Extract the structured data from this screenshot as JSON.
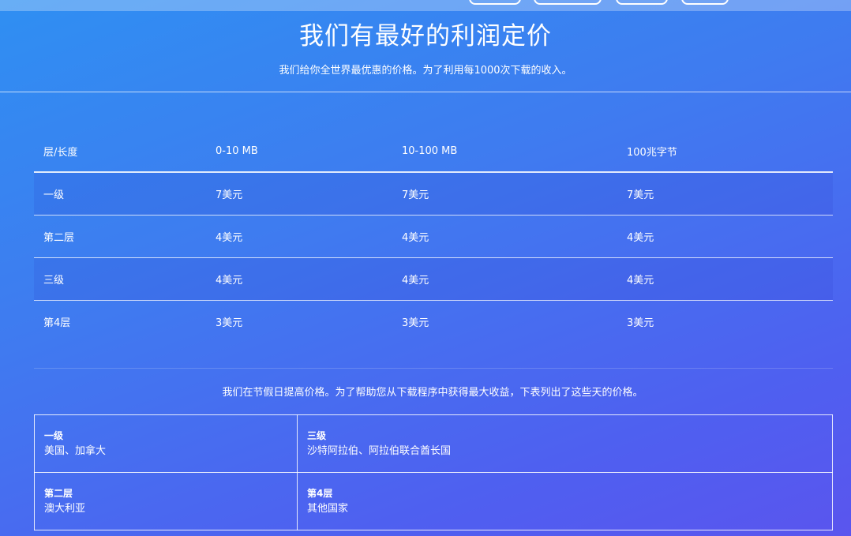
{
  "hero": {
    "title": "我们有最好的利润定价",
    "subtitle": "我们给你全世界最优惠的价格。为了利用每1000次下载的收入。"
  },
  "pricing_table": {
    "headers": [
      "层/长度",
      "0-10 MB",
      "10-100 MB",
      "100兆字节"
    ],
    "rows": [
      [
        "一级",
        "7美元",
        "7美元",
        "7美元"
      ],
      [
        "第二层",
        "4美元",
        "4美元",
        "4美元"
      ],
      [
        "三级",
        "4美元",
        "4美元",
        "4美元"
      ],
      [
        "第4层",
        "3美元",
        "3美元",
        "3美元"
      ]
    ]
  },
  "holiday_note": "我们在节假日提高价格。为了帮助您从下载程序中获得最大收益，下表列出了这些天的价格。",
  "regions": {
    "cells": [
      {
        "tier": "一级",
        "countries": "美国、加拿大"
      },
      {
        "tier": "三级",
        "countries": "沙特阿拉伯、阿拉伯联合酋长国"
      },
      {
        "tier": "第二层",
        "countries": "澳大利亚"
      },
      {
        "tier": "第4层",
        "countries": "其他国家"
      }
    ]
  },
  "colors": {
    "gradient_start": "#2f8ff2",
    "gradient_end": "#5a55ee",
    "text": "#ffffff"
  }
}
